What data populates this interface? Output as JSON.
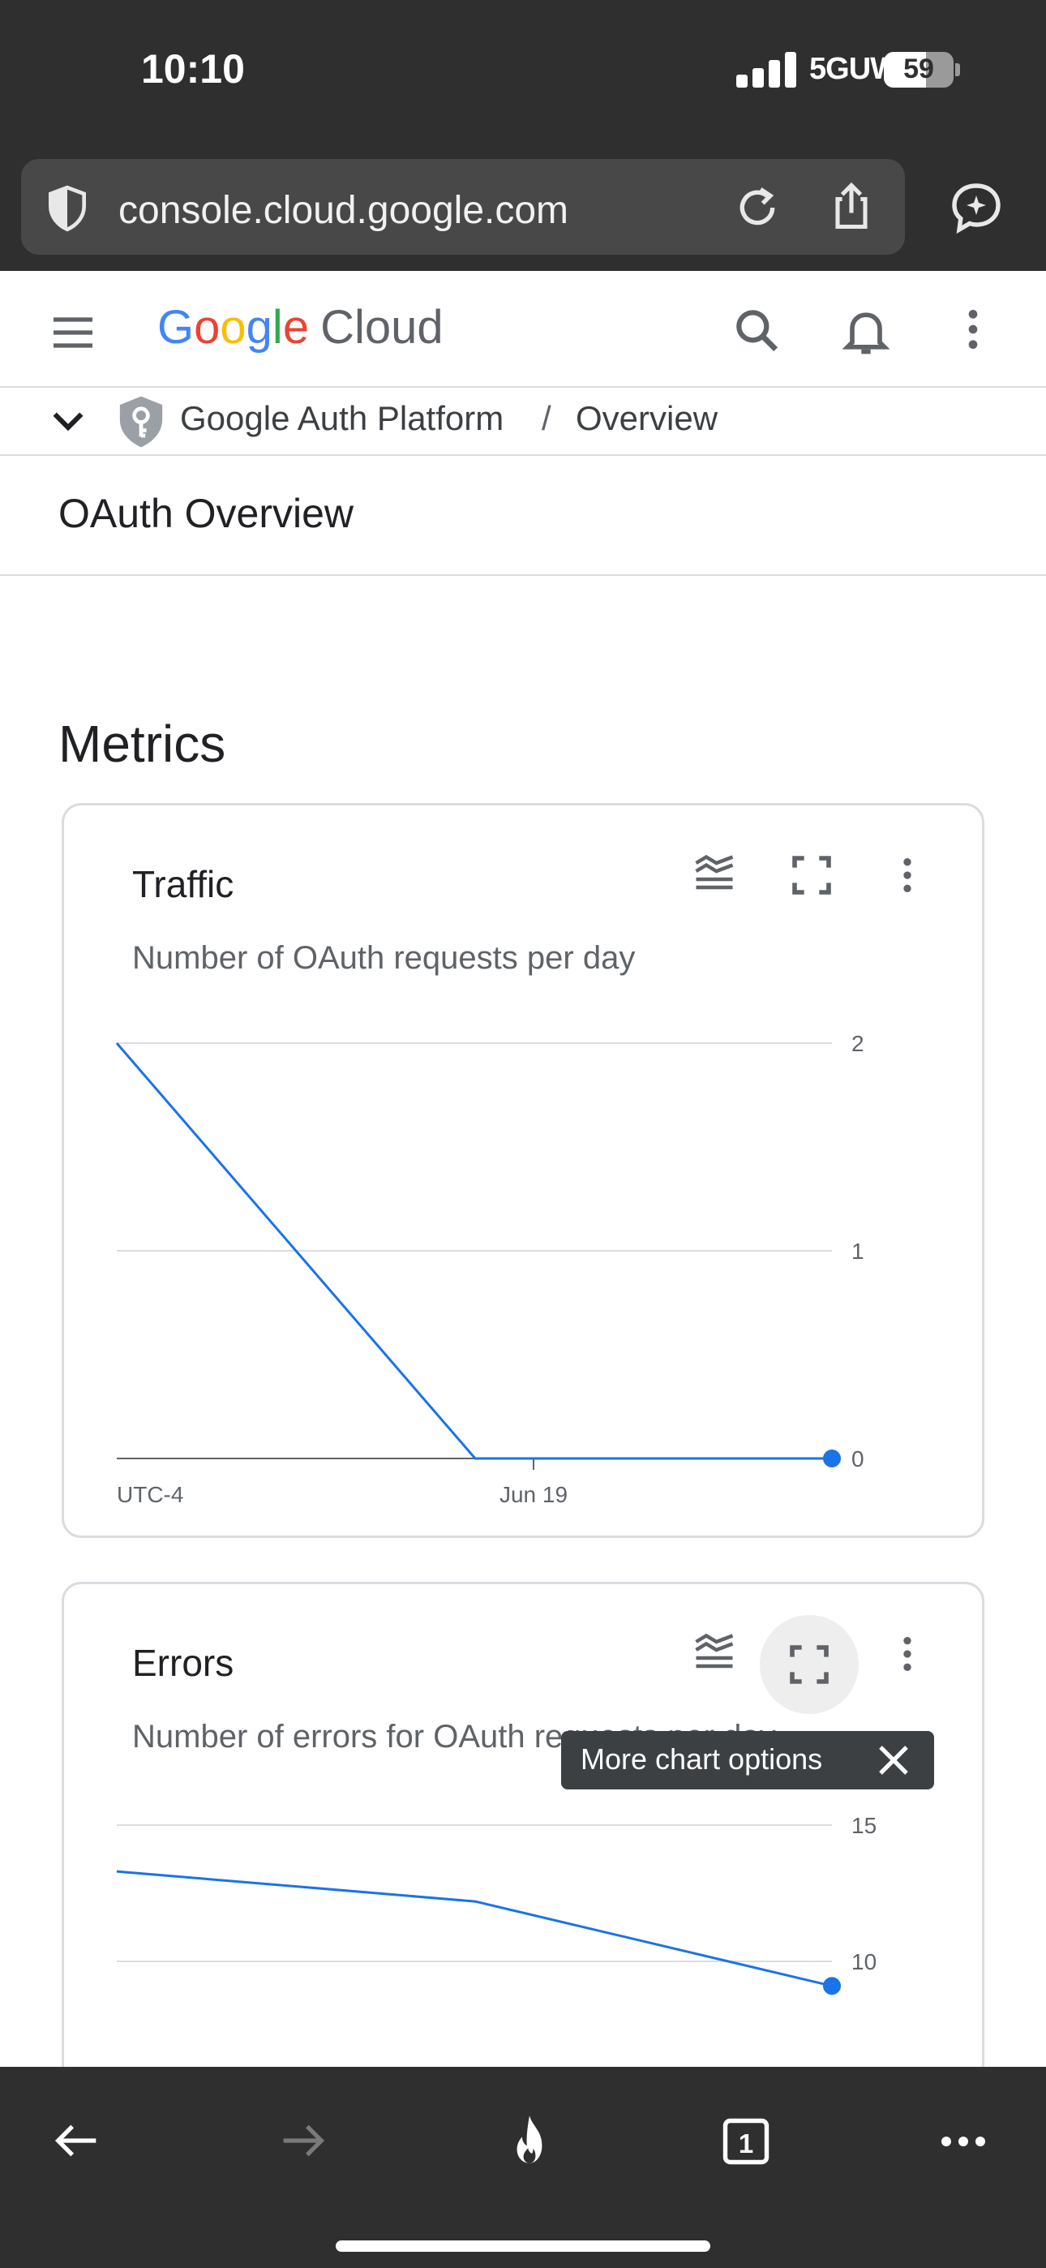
{
  "status_bar": {
    "time": "10:10",
    "network": "5GUW",
    "battery": "59"
  },
  "browser": {
    "url": "console.cloud.google.com"
  },
  "header": {
    "logo_letters": [
      "G",
      "o",
      "o",
      "g",
      "l",
      "e"
    ],
    "logo_product": "Cloud"
  },
  "breadcrumb": {
    "product": "Google Auth Platform",
    "separator": "/",
    "page": "Overview"
  },
  "page": {
    "title": "OAuth Overview",
    "section": "Metrics"
  },
  "cards": [
    {
      "title": "Traffic",
      "subtitle": "Number of OAuth requests per day"
    },
    {
      "title": "Errors",
      "subtitle": "Number of errors for OAuth requests per day"
    }
  ],
  "chart_data": [
    {
      "type": "line",
      "x": [
        "start",
        "Jun 19",
        "end"
      ],
      "series": [
        {
          "values": [
            2,
            0,
            0
          ]
        }
      ],
      "xtick_labels": [
        "UTC-4",
        "Jun 19"
      ],
      "ytick_labels": [
        "2",
        "1",
        "0"
      ],
      "ylim": [
        0,
        2
      ],
      "line_color": "#1a73e8"
    },
    {
      "type": "line",
      "x": [
        "start",
        "Jun 19",
        "end"
      ],
      "series": [
        {
          "values": [
            13.3,
            12.2,
            9.1
          ]
        }
      ],
      "ytick_labels": [
        "15",
        "10"
      ],
      "ylim": [
        10,
        15
      ],
      "line_color": "#1a73e8"
    }
  ],
  "tooltip": {
    "text": "More chart options"
  }
}
